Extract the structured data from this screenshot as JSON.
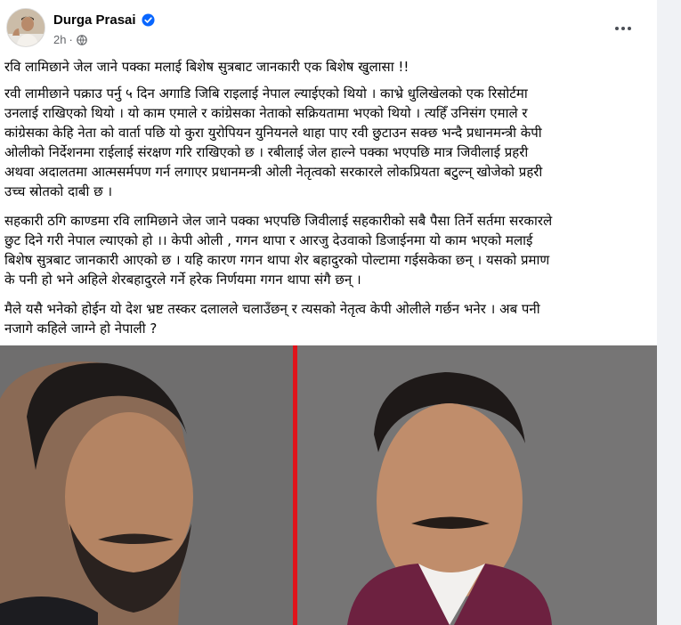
{
  "post": {
    "author": "Durga Prasai",
    "time": "2h",
    "headline": "रवि लामिछाने जेल जाने पक्का मलाई बिशेष सुत्रबाट जानकारी एक बिशेष खुलासा !!",
    "paragraph1_lines": [
      "रवी लामीछाने पक्राउ पर्नु ५ दिन अगाडि जिबि राइलाई नेपाल ल्याईएको थियो । काभ्रे धुलिखेलको एक रिसोर्टमा",
      "उनलाई राखिएको थियो । यो काम एमाले र कांग्रेसका नेताको सक्रियतामा भएको थियो । त्यहिँ उनिसंग एमाले र",
      "कांग्रेसका केहि नेता को वार्ता पछि यो कुरा युरोपियन युनियनले थाहा पाए रवी छुटाउन सक्छ भन्दै प्रधानमन्त्री केपी",
      "ओलीको निर्देशनमा राईलाई  संरक्षण गरि राखिएको छ । रबीलाई जेल हाल्ने पक्का भएपछि मात्र जिवीलाई प्रहरी",
      "अथवा अदालतमा आत्मसर्मपण गर्न लगाएर प्रधानमन्त्री ओली नेतृत्वको सरकारले लोकप्रियता बटुल्न् खोजेको प्रहरी",
      "उच्च स्रोतको दाबी छ ।"
    ],
    "paragraph2_lines": [
      "सहकारी ठगि काण्डमा रवि लामिछाने जेल जाने पक्का भएपछि जिवीलाई सहकारीको सबै पैसा तिर्ने सर्तमा सरकारले",
      "छुट दिने गरी नेपाल ल्याएको हो ।।  केपी ओली , गगन थापा र आरजु देउवाको डिजाईनमा यो काम भएको मलाई",
      "बिशेष सुत्रबाट जानकारी आएको छ । यहि कारण गगन थापा शेर बहादुरको पोल्टामा गईसकेका छन् । यसको प्रमाण",
      "के पनी हो भने अहिले शेरबहादुरले गर्ने हरेक निर्णयमा गगन थापा संगै छन् ।"
    ],
    "paragraph3_lines": [
      "मैले यसै भनेको होईन यो देश भ्रष्ट तस्कर दलालले चलाउँछन् र त्यसको नेतृत्व केपी ओलीले गर्छन भनेर । अब पनी",
      "नजागे कहिले जाग्ने हो नेपाली ?"
    ]
  },
  "icons": {
    "verified": "verified-badge-icon",
    "audience": "globe-icon",
    "more": "more-options-icon"
  },
  "colors": {
    "verified_blue": "#0866ff",
    "divider_red": "#e0141b",
    "photo_bg": "#6f6e6e"
  }
}
